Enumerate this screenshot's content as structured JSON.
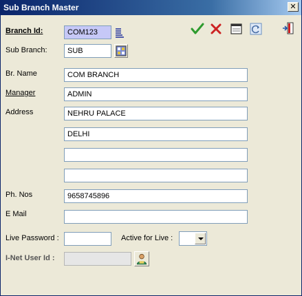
{
  "window": {
    "title": "Sub Branch Master",
    "close_glyph": "✕"
  },
  "toolbar": {
    "icons": [
      "checkmark-icon",
      "cross-icon",
      "card-icon",
      "refresh-icon",
      "exit-icon"
    ],
    "colors": {
      "accept": "#2e9b2e",
      "cancel": "#cc2222"
    }
  },
  "form": {
    "branch_id": {
      "label": "Branch Id:",
      "value": "COM123"
    },
    "sub_branch": {
      "label": "Sub Branch:",
      "value": "SUB"
    },
    "br_name": {
      "label": "Br. Name",
      "value": "COM BRANCH"
    },
    "manager": {
      "label": "Manager",
      "value": "ADMIN"
    },
    "address": {
      "label": "Address",
      "lines": [
        "NEHRU PALACE",
        "DELHI",
        "",
        ""
      ]
    },
    "phone": {
      "label": "Ph. Nos",
      "value": "9658745896"
    },
    "email": {
      "label": "E Mail",
      "value": ""
    },
    "live_password": {
      "label": "Live Password :",
      "value": ""
    },
    "active_for_live": {
      "label": "Active for Live :",
      "value": ""
    },
    "inet_user_id": {
      "label": "I-Net  User Id :",
      "value": ""
    }
  }
}
